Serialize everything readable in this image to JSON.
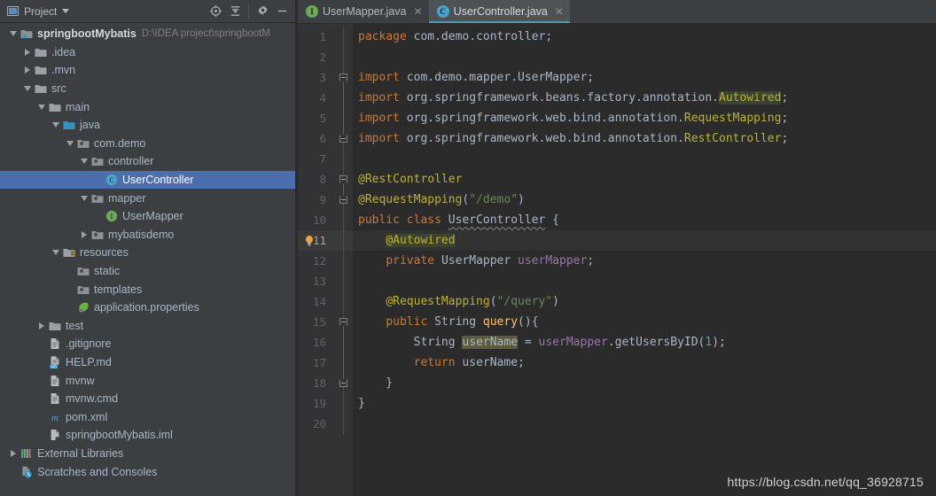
{
  "project_panel": {
    "title": "Project",
    "title_icon": "project-window-icon",
    "dropdown_icon": "chevron-down-icon",
    "toolbar_buttons": [
      {
        "name": "locate-icon",
        "label": "Select Opened File"
      },
      {
        "name": "collapse-all-icon",
        "label": "Collapse All"
      },
      {
        "name": "gear-icon",
        "label": "Settings"
      },
      {
        "name": "minimize-icon",
        "label": "Hide"
      }
    ],
    "tree": [
      {
        "label": "springbootMybatis",
        "path": "D:\\IDEA project\\springbootM",
        "icon": "module-icon",
        "indent": 0,
        "arrow": "open",
        "style": "root"
      },
      {
        "label": ".idea",
        "icon": "folder-icon",
        "indent": 1,
        "arrow": "closed"
      },
      {
        "label": ".mvn",
        "icon": "folder-icon",
        "indent": 1,
        "arrow": "closed"
      },
      {
        "label": "src",
        "icon": "folder-icon",
        "indent": 1,
        "arrow": "open"
      },
      {
        "label": "main",
        "icon": "folder-icon",
        "indent": 2,
        "arrow": "open"
      },
      {
        "label": "java",
        "icon": "source-root-folder-icon",
        "indent": 3,
        "arrow": "open"
      },
      {
        "label": "com.demo",
        "icon": "package-icon",
        "indent": 4,
        "arrow": "open"
      },
      {
        "label": "controller",
        "icon": "package-icon",
        "indent": 5,
        "arrow": "open"
      },
      {
        "label": "UserController",
        "icon": "java-class-icon",
        "indent": 6,
        "arrow": "none",
        "selected": true
      },
      {
        "label": "mapper",
        "icon": "package-icon",
        "indent": 5,
        "arrow": "open"
      },
      {
        "label": "UserMapper",
        "icon": "java-interface-icon",
        "indent": 6,
        "arrow": "none"
      },
      {
        "label": "mybatisdemo",
        "icon": "package-icon",
        "indent": 5,
        "arrow": "closed"
      },
      {
        "label": "resources",
        "icon": "resources-root-folder-icon",
        "indent": 3,
        "arrow": "open"
      },
      {
        "label": "static",
        "icon": "package-icon",
        "indent": 4,
        "arrow": "none"
      },
      {
        "label": "templates",
        "icon": "package-icon",
        "indent": 4,
        "arrow": "none"
      },
      {
        "label": "application.properties",
        "icon": "spring-properties-icon",
        "indent": 4,
        "arrow": "none"
      },
      {
        "label": "test",
        "icon": "folder-icon",
        "indent": 2,
        "arrow": "closed"
      },
      {
        "label": ".gitignore",
        "icon": "file-text-icon",
        "indent": 2,
        "arrow": "none"
      },
      {
        "label": "HELP.md",
        "icon": "markdown-file-icon",
        "indent": 2,
        "arrow": "none"
      },
      {
        "label": "mvnw",
        "icon": "file-text-icon",
        "indent": 2,
        "arrow": "none"
      },
      {
        "label": "mvnw.cmd",
        "icon": "file-text-icon",
        "indent": 2,
        "arrow": "none"
      },
      {
        "label": "pom.xml",
        "icon": "maven-file-icon",
        "indent": 2,
        "arrow": "none"
      },
      {
        "label": "springbootMybatis.iml",
        "icon": "iml-file-icon",
        "indent": 2,
        "arrow": "none"
      },
      {
        "label": "External Libraries",
        "icon": "libraries-icon",
        "indent": 0,
        "arrow": "closed"
      },
      {
        "label": "Scratches and Consoles",
        "icon": "scratches-icon",
        "indent": 0,
        "arrow": "none"
      }
    ]
  },
  "editor": {
    "tabs": [
      {
        "label": "UserMapper.java",
        "icon": "java-interface-icon",
        "badge": "I",
        "active": false,
        "close_icon": "close-icon"
      },
      {
        "label": "UserController.java",
        "icon": "java-class-icon",
        "badge": "C",
        "active": true,
        "close_icon": "close-icon"
      }
    ],
    "active_line": 11,
    "line_numbers": [
      1,
      2,
      3,
      4,
      5,
      6,
      7,
      8,
      9,
      10,
      11,
      12,
      13,
      14,
      15,
      16,
      17,
      18,
      19,
      20
    ],
    "code_lines": [
      {
        "n": 1,
        "tokens": [
          {
            "t": "package ",
            "c": "kw"
          },
          {
            "t": "com.demo.controller",
            "c": "pln"
          },
          {
            "t": ";",
            "c": "pln"
          }
        ]
      },
      {
        "n": 2,
        "tokens": []
      },
      {
        "n": 3,
        "tokens": [
          {
            "t": "import ",
            "c": "kw"
          },
          {
            "t": "com.demo.mapper.UserMapper",
            "c": "pln"
          },
          {
            "t": ";",
            "c": "pln"
          }
        ]
      },
      {
        "n": 4,
        "tokens": [
          {
            "t": "import ",
            "c": "kw"
          },
          {
            "t": "org.springframework.beans.factory.annotation.",
            "c": "pln"
          },
          {
            "t": "Autowired",
            "c": "ann hlann"
          },
          {
            "t": ";",
            "c": "pln"
          }
        ]
      },
      {
        "n": 5,
        "tokens": [
          {
            "t": "import ",
            "c": "kw"
          },
          {
            "t": "org.springframework.web.bind.annotation.",
            "c": "pln"
          },
          {
            "t": "RequestMapping",
            "c": "ann"
          },
          {
            "t": ";",
            "c": "pln"
          }
        ]
      },
      {
        "n": 6,
        "tokens": [
          {
            "t": "import ",
            "c": "kw"
          },
          {
            "t": "org.springframework.web.bind.annotation.",
            "c": "pln"
          },
          {
            "t": "RestController",
            "c": "ann"
          },
          {
            "t": ";",
            "c": "pln"
          }
        ]
      },
      {
        "n": 7,
        "tokens": []
      },
      {
        "n": 8,
        "tokens": [
          {
            "t": "@RestController",
            "c": "ann"
          }
        ]
      },
      {
        "n": 9,
        "tokens": [
          {
            "t": "@RequestMapping",
            "c": "ann"
          },
          {
            "t": "(",
            "c": "pln"
          },
          {
            "t": "\"/demo\"",
            "c": "str"
          },
          {
            "t": ")",
            "c": "pln"
          }
        ]
      },
      {
        "n": 10,
        "tokens": [
          {
            "t": "public ",
            "c": "kw"
          },
          {
            "t": "class ",
            "c": "kw"
          },
          {
            "t": "UserController",
            "c": "cls wavy"
          },
          {
            "t": " {",
            "c": "pln"
          }
        ]
      },
      {
        "n": 11,
        "tokens": [
          {
            "t": "    ",
            "c": "pln"
          },
          {
            "t": "@Autowired",
            "c": "ann hlann"
          }
        ]
      },
      {
        "n": 12,
        "tokens": [
          {
            "t": "    ",
            "c": "pln"
          },
          {
            "t": "private ",
            "c": "kw"
          },
          {
            "t": "UserMapper ",
            "c": "cls"
          },
          {
            "t": "userMapper",
            "c": "fld"
          },
          {
            "t": ";",
            "c": "pln"
          }
        ]
      },
      {
        "n": 13,
        "tokens": []
      },
      {
        "n": 14,
        "tokens": [
          {
            "t": "    ",
            "c": "pln"
          },
          {
            "t": "@RequestMapping",
            "c": "ann"
          },
          {
            "t": "(",
            "c": "pln"
          },
          {
            "t": "\"/query\"",
            "c": "str"
          },
          {
            "t": ")",
            "c": "pln"
          }
        ]
      },
      {
        "n": 15,
        "tokens": [
          {
            "t": "    ",
            "c": "pln"
          },
          {
            "t": "public ",
            "c": "kw"
          },
          {
            "t": "String ",
            "c": "cls"
          },
          {
            "t": "query",
            "c": "mth"
          },
          {
            "t": "(){",
            "c": "pln"
          }
        ]
      },
      {
        "n": 16,
        "tokens": [
          {
            "t": "        ",
            "c": "pln"
          },
          {
            "t": "String ",
            "c": "cls"
          },
          {
            "t": "userName",
            "c": "hlsearch"
          },
          {
            "t": " = ",
            "c": "pln"
          },
          {
            "t": "userMapper",
            "c": "fld"
          },
          {
            "t": ".getUsersByID(",
            "c": "pln"
          },
          {
            "t": "1",
            "c": "num"
          },
          {
            "t": ");",
            "c": "pln"
          }
        ]
      },
      {
        "n": 17,
        "tokens": [
          {
            "t": "        ",
            "c": "pln"
          },
          {
            "t": "return ",
            "c": "kw"
          },
          {
            "t": "userName",
            "c": "pln"
          },
          {
            "t": ";",
            "c": "pln"
          }
        ]
      },
      {
        "n": 18,
        "tokens": [
          {
            "t": "    }",
            "c": "pln"
          }
        ]
      },
      {
        "n": 19,
        "tokens": [
          {
            "t": "}",
            "c": "pln"
          }
        ]
      },
      {
        "n": 20,
        "tokens": []
      }
    ],
    "gutter_icons": [
      {
        "name": "intention-bulb-icon",
        "line": 11
      }
    ],
    "fold_markers": [
      {
        "name": "fold-region-start-icon",
        "line": 3,
        "type": "start"
      },
      {
        "name": "fold-region-end-icon",
        "line": 6,
        "type": "end"
      },
      {
        "name": "fold-region-start-icon",
        "line": 8,
        "type": "start"
      },
      {
        "name": "fold-region-end-icon",
        "line": 9,
        "type": "end"
      },
      {
        "name": "fold-region-start-icon",
        "line": 15,
        "type": "start"
      },
      {
        "name": "fold-region-end-icon",
        "line": 18,
        "type": "end"
      }
    ]
  },
  "watermark": {
    "text": "https://blog.csdn.net/qq_36928715"
  },
  "colors": {
    "panel_bg": "#3c3f41",
    "editor_bg": "#2b2b2b",
    "gutter_bg": "#313335",
    "selection_blue": "#4b6eaf",
    "active_tab_underline": "#4a9ab0",
    "keyword_orange": "#cc7832",
    "string_green": "#6a8759",
    "annotation_yellow": "#bbb529",
    "field_purple": "#9876aa",
    "method_gold": "#ffc66d",
    "number_blue": "#6897bb",
    "text_default": "#a9b7c6"
  }
}
